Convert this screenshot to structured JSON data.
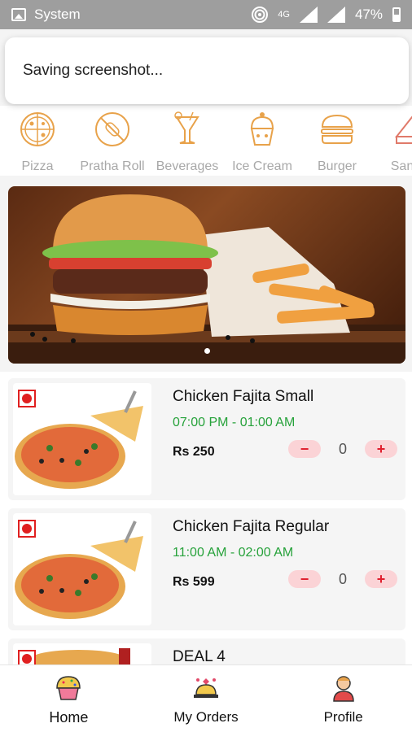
{
  "statusbar": {
    "app_name": "System",
    "network": "4G",
    "battery": "47%"
  },
  "toast": {
    "message": "Saving screenshot..."
  },
  "categories": [
    {
      "label": "Pizza",
      "icon": "pizza-icon"
    },
    {
      "label": "Pratha Roll",
      "icon": "roll-icon"
    },
    {
      "label": "Beverages",
      "icon": "beverage-icon"
    },
    {
      "label": "Ice Cream",
      "icon": "ice-cream-icon"
    },
    {
      "label": "Burger",
      "icon": "burger-icon"
    },
    {
      "label": "Sandwi",
      "icon": "sandwich-icon"
    }
  ],
  "banner": {
    "slides": 1,
    "active_slide": 1
  },
  "items": [
    {
      "title": "Chicken Fajita Small",
      "time": "07:00 PM - 01:00 AM",
      "price": "Rs 250",
      "qty": "0",
      "minus": "−",
      "plus": "+"
    },
    {
      "title": "Chicken Fajita Regular",
      "time": "11:00 AM - 02:00 AM",
      "price": "Rs 599",
      "qty": "0",
      "minus": "−",
      "plus": "+"
    },
    {
      "title": "DEAL 4"
    }
  ],
  "nav": [
    {
      "label": "Home",
      "icon": "cupcake-icon"
    },
    {
      "label": "My Orders",
      "icon": "orders-icon"
    },
    {
      "label": "Profile",
      "icon": "profile-icon"
    }
  ],
  "colors": {
    "accent_orange": "#e8a24a",
    "time_green": "#27a23b",
    "stepper_bg": "#fbd3d6",
    "stepper_red": "#e0202f"
  }
}
